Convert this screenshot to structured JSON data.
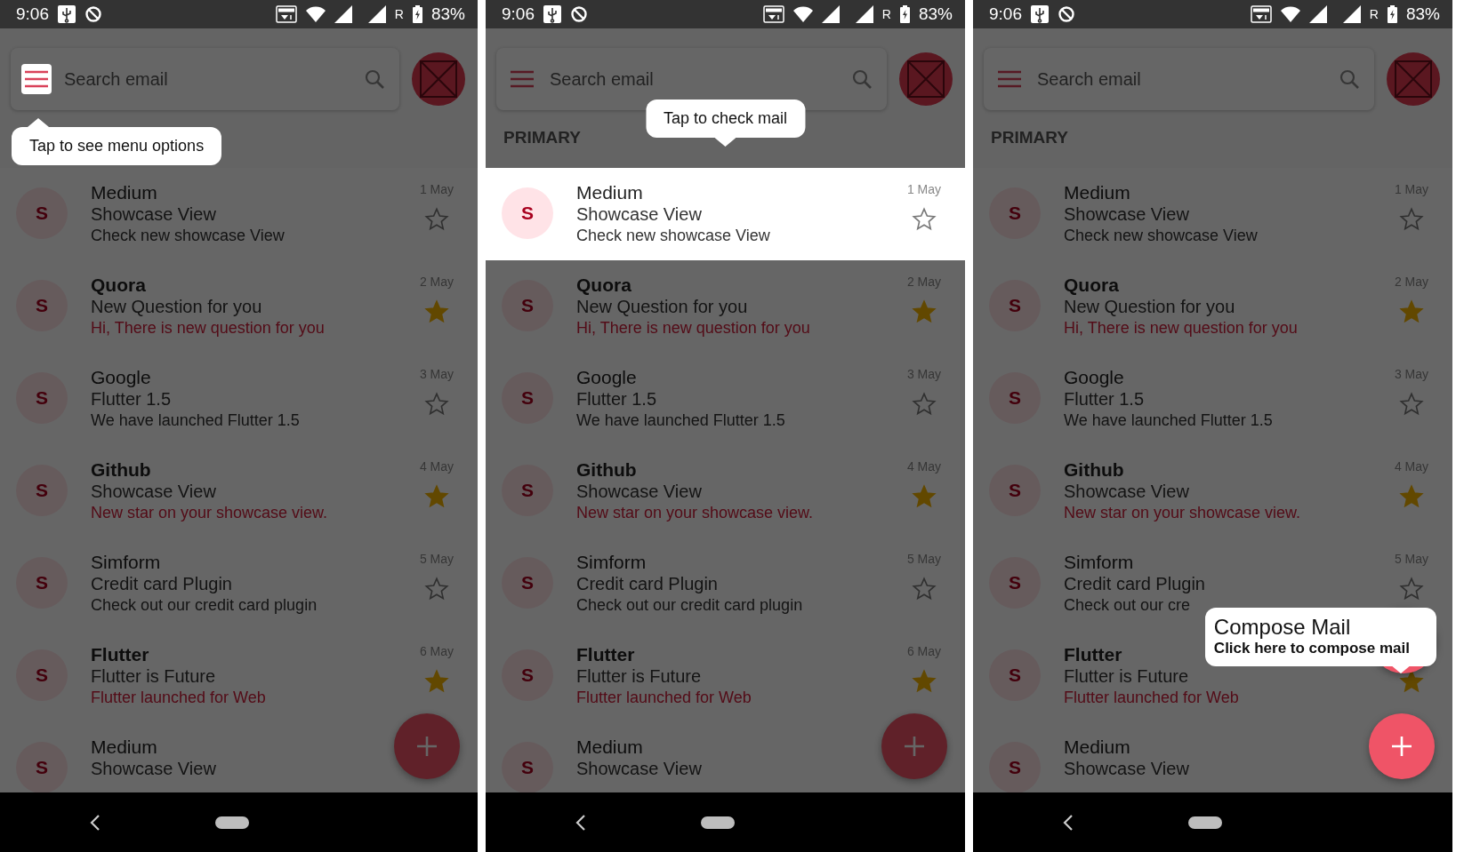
{
  "screens": [
    {
      "status_bar": {
        "time": "9:06",
        "network": "R",
        "battery": "83%"
      },
      "search": {
        "placeholder": "Search email"
      },
      "showcase": {
        "kind": "menu",
        "description": "Tap to see menu options"
      },
      "emails": [
        {
          "avatar": "S",
          "sender": "Medium",
          "subject": "Showcase View",
          "preview": "Check new showcase View",
          "date": "1 May",
          "unread": false,
          "starred": false
        },
        {
          "avatar": "S",
          "sender": "Quora",
          "subject": "New Question for you",
          "preview": "Hi, There is new question for you",
          "date": "2 May",
          "unread": true,
          "starred": true
        },
        {
          "avatar": "S",
          "sender": "Google",
          "subject": "Flutter 1.5",
          "preview": "We have launched Flutter 1.5",
          "date": "3 May",
          "unread": false,
          "starred": false
        },
        {
          "avatar": "S",
          "sender": "Github",
          "subject": "Showcase View",
          "preview": "New star on your showcase view.",
          "date": "4 May",
          "unread": true,
          "starred": true
        },
        {
          "avatar": "S",
          "sender": "Simform",
          "subject": "Credit card Plugin",
          "preview": "Check out our credit card plugin",
          "date": "5 May",
          "unread": false,
          "starred": false
        },
        {
          "avatar": "S",
          "sender": "Flutter",
          "subject": "Flutter is Future",
          "preview": "Flutter launched for Web",
          "date": "6 May",
          "unread": true,
          "starred": true
        },
        {
          "avatar": "S",
          "sender": "Medium",
          "subject": "Showcase View",
          "unread": false
        }
      ]
    },
    {
      "status_bar": {
        "time": "9:06",
        "network": "R",
        "battery": "83%"
      },
      "search": {
        "placeholder": "Search email"
      },
      "section": "PRIMARY",
      "showcase": {
        "kind": "email",
        "description": "Tap to check mail"
      },
      "emails": [
        {
          "avatar": "S",
          "sender": "Medium",
          "subject": "Showcase View",
          "preview": "Check new showcase View",
          "date": "1 May",
          "unread": false,
          "starred": false
        },
        {
          "avatar": "S",
          "sender": "Quora",
          "subject": "New Question for you",
          "preview": "Hi, There is new question for you",
          "date": "2 May",
          "unread": true,
          "starred": true
        },
        {
          "avatar": "S",
          "sender": "Google",
          "subject": "Flutter 1.5",
          "preview": "We have launched Flutter 1.5",
          "date": "3 May",
          "unread": false,
          "starred": false
        },
        {
          "avatar": "S",
          "sender": "Github",
          "subject": "Showcase View",
          "preview": "New star on your showcase view.",
          "date": "4 May",
          "unread": true,
          "starred": true
        },
        {
          "avatar": "S",
          "sender": "Simform",
          "subject": "Credit card Plugin",
          "preview": "Check out our credit card plugin",
          "date": "5 May",
          "unread": false,
          "starred": false
        },
        {
          "avatar": "S",
          "sender": "Flutter",
          "subject": "Flutter is Future",
          "preview": "Flutter launched for Web",
          "date": "6 May",
          "unread": true,
          "starred": true
        },
        {
          "avatar": "S",
          "sender": "Medium",
          "subject": "Showcase View",
          "unread": false
        }
      ]
    },
    {
      "status_bar": {
        "time": "9:06",
        "network": "R",
        "battery": "83%"
      },
      "search": {
        "placeholder": "Search email"
      },
      "section": "PRIMARY",
      "showcase": {
        "kind": "fab",
        "title": "Compose Mail",
        "description": "Click here to compose mail"
      },
      "emails": [
        {
          "avatar": "S",
          "sender": "Medium",
          "subject": "Showcase View",
          "preview": "Check new showcase View",
          "date": "1 May",
          "unread": false,
          "starred": false
        },
        {
          "avatar": "S",
          "sender": "Quora",
          "subject": "New Question for you",
          "preview": "Hi, There is new question for you",
          "date": "2 May",
          "unread": true,
          "starred": true
        },
        {
          "avatar": "S",
          "sender": "Google",
          "subject": "Flutter 1.5",
          "preview": "We have launched Flutter 1.5",
          "date": "3 May",
          "unread": false,
          "starred": false
        },
        {
          "avatar": "S",
          "sender": "Github",
          "subject": "Showcase View",
          "preview": "New star on your showcase view.",
          "date": "4 May",
          "unread": true,
          "starred": true
        },
        {
          "avatar": "S",
          "sender": "Simform",
          "subject": "Credit card Plugin",
          "preview": "Check out our cre",
          "date": "5 May",
          "unread": false,
          "starred": false
        },
        {
          "avatar": "S",
          "sender": "Flutter",
          "subject": "Flutter is Future",
          "preview": "Flutter launched for Web",
          "unread": true,
          "starred": true
        },
        {
          "avatar": "S",
          "sender": "Medium",
          "subject": "Showcase View",
          "unread": false
        }
      ]
    }
  ]
}
